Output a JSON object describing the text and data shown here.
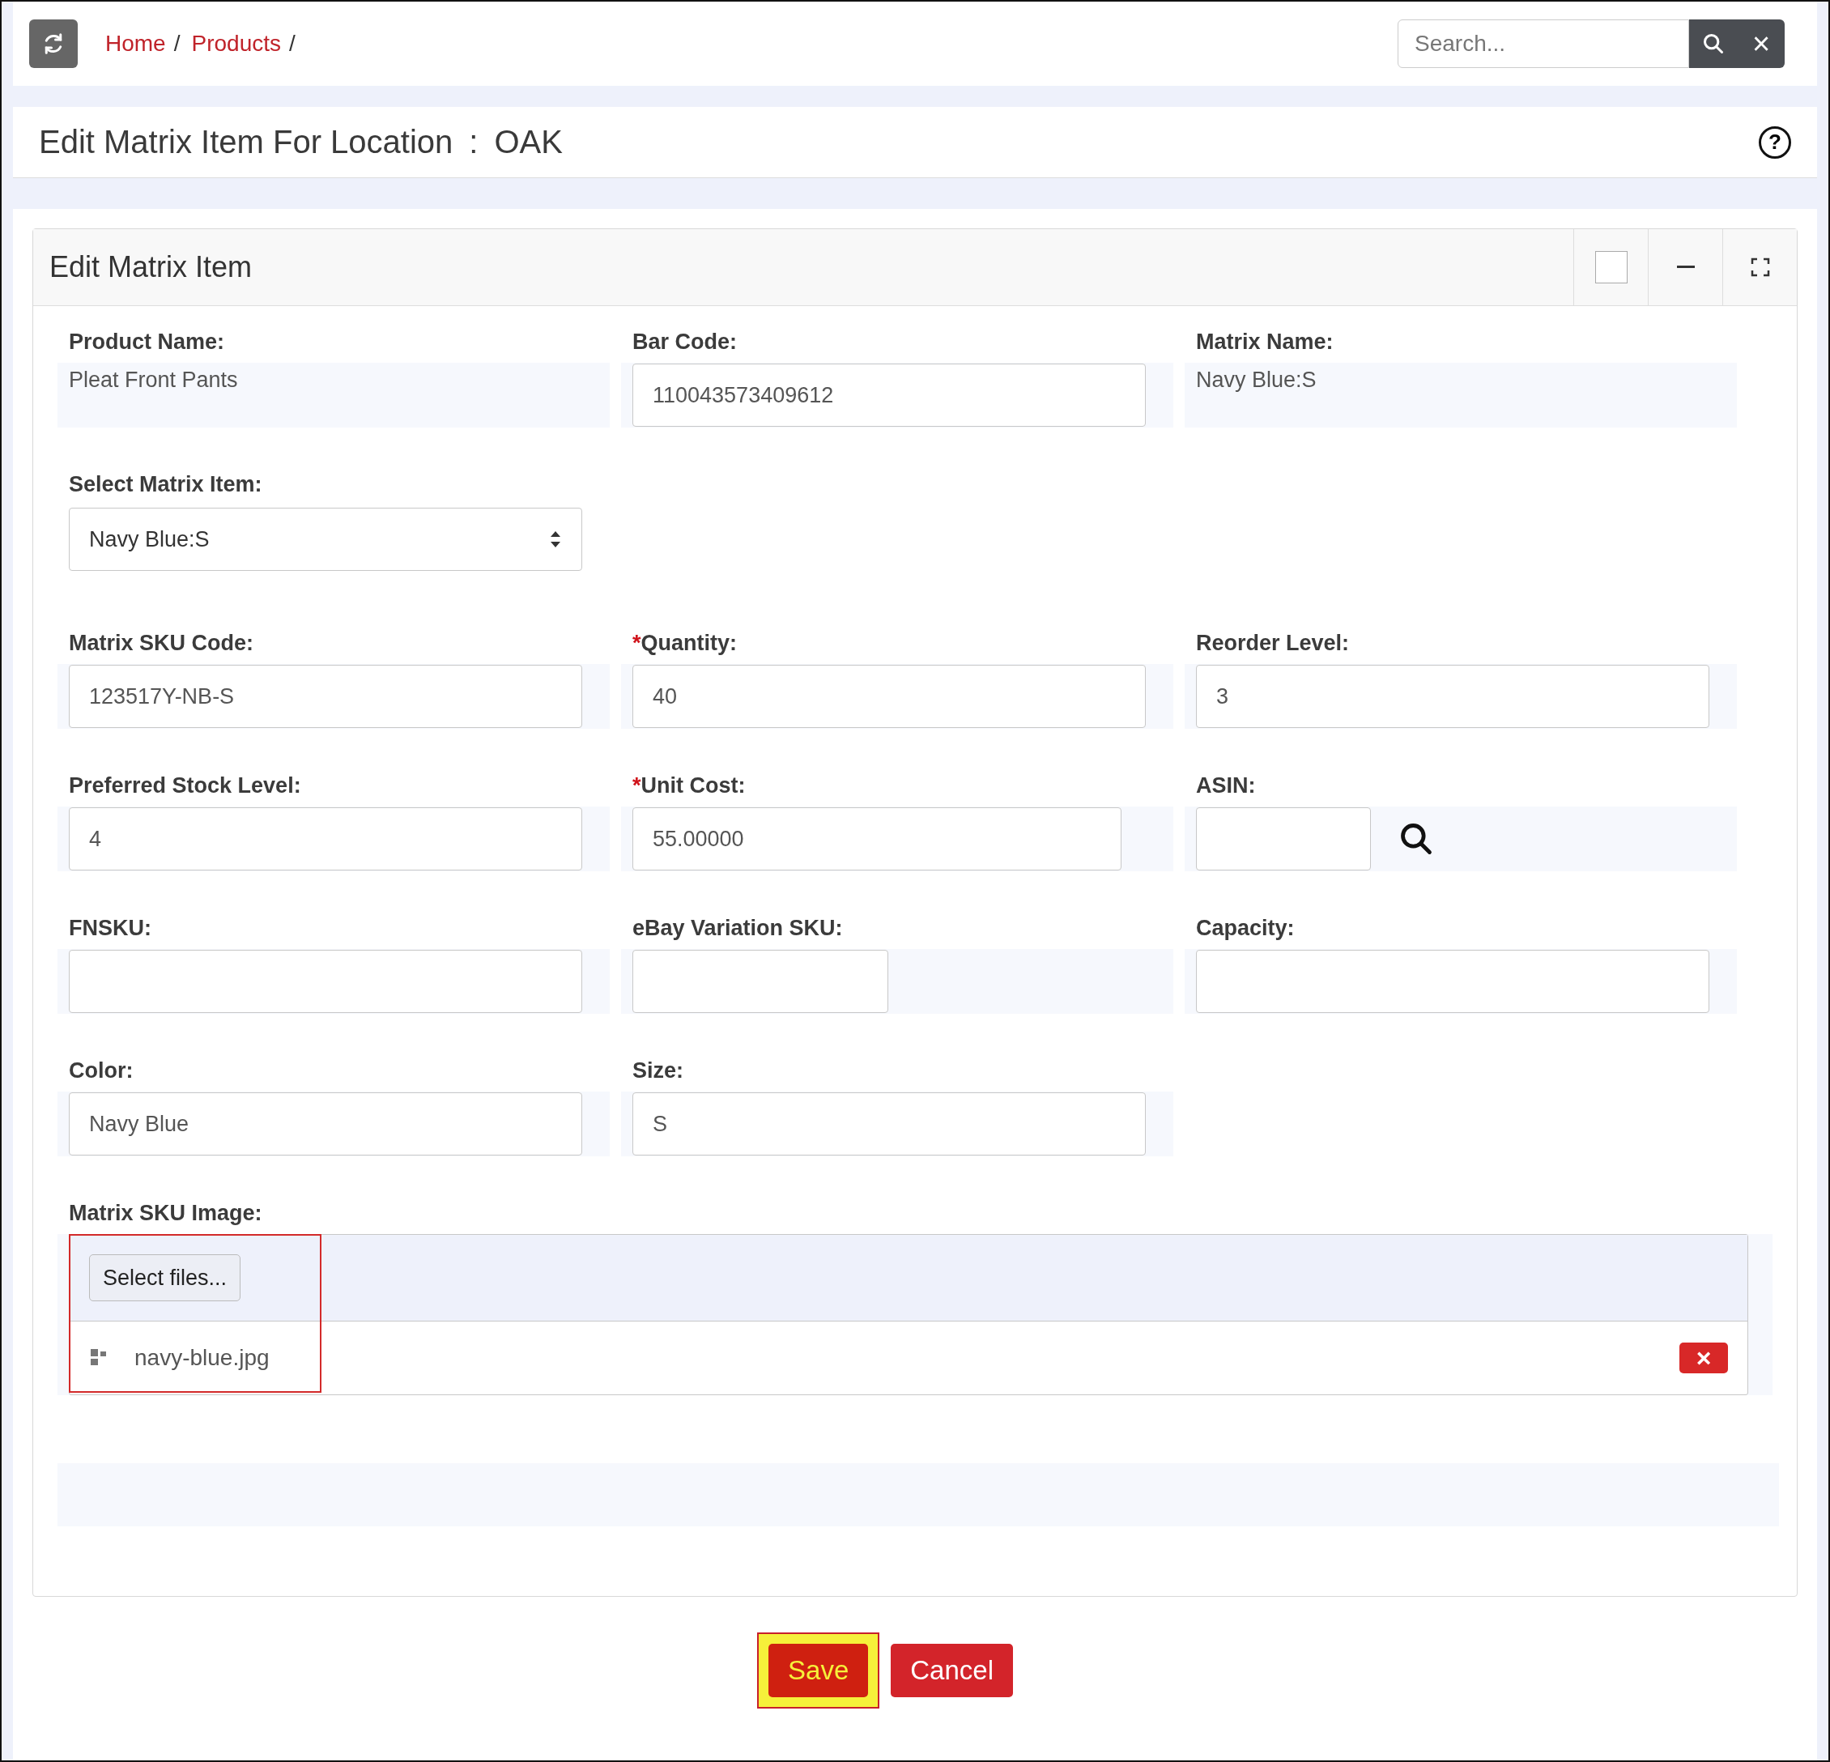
{
  "topbar": {
    "breadcrumbs": [
      "Home",
      "Products"
    ],
    "breadcrumb_separator": "/",
    "search": {
      "placeholder": "Search..."
    },
    "close_glyph": "×"
  },
  "page_title": {
    "text": "Edit Matrix Item For Location",
    "separator": ":",
    "location": "OAK",
    "help_glyph": "?"
  },
  "panel": {
    "title": "Edit Matrix Item"
  },
  "required_mark": "*",
  "rows": [
    [
      {
        "kind": "static",
        "label": "Product Name:",
        "value": "Pleat Front Pants",
        "required": false
      },
      {
        "kind": "input",
        "label": "Bar Code:",
        "value": "110043573409612",
        "required": false
      },
      {
        "kind": "static",
        "label": "Matrix Name:",
        "value": "Navy Blue:S",
        "required": false
      }
    ],
    [
      {
        "kind": "select",
        "label": "Select Matrix Item:",
        "value": "Navy Blue:S",
        "required": false
      }
    ],
    [
      {
        "kind": "input",
        "label": "Matrix SKU Code:",
        "value": "123517Y-NB-S",
        "required": false
      },
      {
        "kind": "input",
        "label": "Quantity:",
        "value": "40",
        "required": true
      },
      {
        "kind": "input",
        "label": "Reorder Level:",
        "value": "3",
        "required": false
      }
    ],
    [
      {
        "kind": "input",
        "label": "Preferred Stock Level:",
        "value": "4",
        "required": false
      },
      {
        "kind": "input",
        "label": "Unit Cost:",
        "value": "55.00000",
        "required": true
      },
      {
        "kind": "lookup",
        "label": "ASIN:",
        "required": false
      }
    ],
    [
      {
        "kind": "input",
        "label": "FNSKU:",
        "required": false
      },
      {
        "kind": "input",
        "label": "eBay Variation SKU:",
        "required": false
      },
      {
        "kind": "input",
        "label": "Capacity:",
        "required": false
      }
    ],
    [
      {
        "kind": "input",
        "label": "Color:",
        "value": "Navy Blue",
        "required": false
      },
      {
        "kind": "input",
        "label": "Size:",
        "value": "S",
        "required": false
      }
    ]
  ],
  "upload": {
    "label": "Matrix SKU Image:",
    "button": "Select files...",
    "highlighted": true,
    "files": [
      {
        "name": "navy-blue.jpg",
        "remove_glyph": "×"
      }
    ]
  },
  "actions": [
    {
      "label": "Save",
      "kind": "primary",
      "highlighted": true
    },
    {
      "label": "Cancel",
      "kind": "secondary",
      "highlighted": false
    }
  ]
}
